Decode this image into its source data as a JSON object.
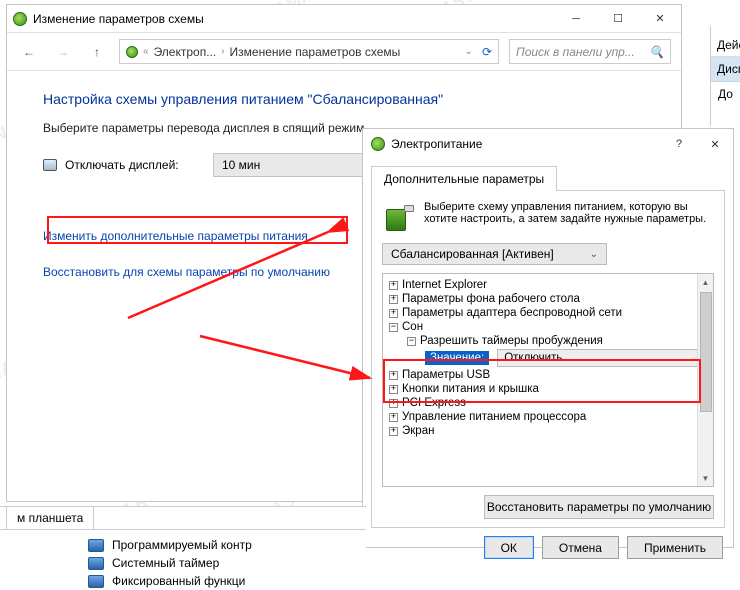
{
  "window1": {
    "title": "Изменение параметров схемы",
    "breadcrumb": {
      "item1": "Электроп...",
      "item2": "Изменение параметров схемы"
    },
    "search_placeholder": "Поиск в панели упр...",
    "heading": "Настройка схемы управления питанием \"Сбалансированная\"",
    "subtext": "Выберите параметры перевода дисплея в спящий режим.",
    "display_off_label": "Отключать дисплей:",
    "display_off_value": "10 мин",
    "link_advanced": "Изменить дополнительные параметры питания",
    "link_restore": "Восстановить для схемы параметры по умолчанию"
  },
  "sidebar": {
    "header": "Действ",
    "item1": "Диспетч",
    "item2": "До"
  },
  "dialog": {
    "title": "Электропитание",
    "tab": "Дополнительные параметры",
    "intro": "Выберите схему управления питанием, которую вы хотите настроить, а затем задайте нужные параметры.",
    "scheme": "Сбалансированная [Активен]",
    "tree": {
      "ie": "Internet Explorer",
      "bg": "Параметры фона рабочего стола",
      "wifi": "Параметры адаптера беспроводной сети",
      "sleep": "Сон",
      "wake": "Разрешить таймеры пробуждения",
      "value_label": "Значение:",
      "value": "Отключить",
      "usb": "Параметры USB",
      "buttons": "Кнопки питания и крышка",
      "pci": "PCI Express",
      "cpu": "Управление питанием процессора",
      "screen": "Экран"
    },
    "restore": "Восстановить параметры по умолчанию",
    "ok": "ОК",
    "cancel": "Отмена",
    "apply": "Применить"
  },
  "bottom": {
    "tab": "м планшета",
    "row1": "Программируемый контр",
    "row2": "Системный таймер",
    "row3": "Фиксированный функци"
  }
}
